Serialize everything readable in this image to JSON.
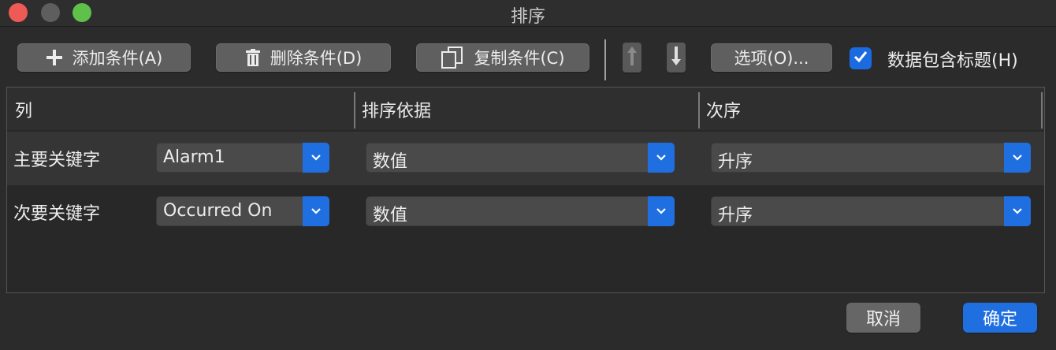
{
  "window": {
    "title": "排序"
  },
  "toolbar": {
    "add_label": "添加条件(A)",
    "delete_label": "删除条件(D)",
    "copy_label": "复制条件(C)",
    "options_label": "选项(O)...",
    "header_checkbox_label": "数据包含标题(H)",
    "header_checkbox_checked": true,
    "icons": {
      "add": "plus-icon",
      "delete": "trash-icon",
      "copy": "copy-icon",
      "up": "arrow-up-icon",
      "down": "arrow-down-icon"
    }
  },
  "table": {
    "headers": [
      "列",
      "排序依据",
      "次序"
    ],
    "rows": [
      {
        "label": "主要关键字",
        "column": "Alarm1",
        "sort_on": "数值",
        "order": "升序"
      },
      {
        "label": "次要关键字",
        "column": "Occurred On",
        "sort_on": "数值",
        "order": "升序"
      }
    ]
  },
  "footer": {
    "cancel_label": "取消",
    "ok_label": "确定"
  },
  "colors": {
    "accent": "#1f6fe0",
    "close": "#ee5a55",
    "minimize": "#5e5e5e",
    "maximize": "#5fc04a",
    "background": "#2b2b2b"
  }
}
